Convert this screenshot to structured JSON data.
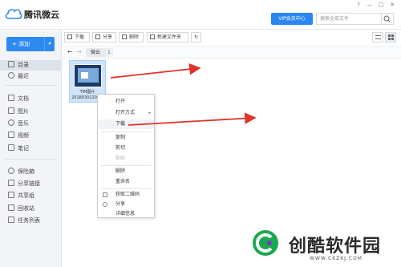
{
  "app": {
    "title": "腾讯微云",
    "vip_label": "VIP会员中心",
    "search_placeholder": "搜索全部文件",
    "window_controls": [
      "?",
      "—",
      "□",
      "✕"
    ]
  },
  "sidebar": {
    "upload_label": "+ 添加",
    "items": [
      {
        "label": "目录",
        "icon": "folder-icon",
        "active": true
      },
      {
        "label": "最近",
        "icon": "clock-icon",
        "active": false
      },
      {
        "label": "文档",
        "icon": "document-icon",
        "active": false
      },
      {
        "label": "图片",
        "icon": "image-icon",
        "active": false
      },
      {
        "label": "音乐",
        "icon": "music-icon",
        "active": false
      },
      {
        "label": "视频",
        "icon": "video-icon",
        "active": false
      },
      {
        "label": "笔记",
        "icon": "note-icon",
        "active": false
      },
      {
        "label": "保险箱",
        "icon": "safe-icon",
        "active": false
      },
      {
        "label": "分享链接",
        "icon": "share-link-icon",
        "active": false
      },
      {
        "label": "共享组",
        "icon": "group-icon",
        "active": false
      },
      {
        "label": "回收站",
        "icon": "trash-icon",
        "active": false
      },
      {
        "label": "任务列表",
        "icon": "task-list-icon",
        "active": false
      }
    ]
  },
  "toolbar": {
    "download": "下载",
    "share": "分享",
    "delete": "删除",
    "new_folder": "新建文件夹"
  },
  "breadcrumb": {
    "current": "微云",
    "count": "1"
  },
  "file": {
    "name_line1": "TIM图片",
    "name_line2": "20180301204..."
  },
  "context_menu": {
    "items": [
      {
        "label": "打开",
        "disabled": false
      },
      {
        "label": "打开方式",
        "disabled": false,
        "submenu": "▸"
      },
      {
        "label": "下载",
        "disabled": false
      },
      {
        "label": "复制",
        "disabled": false
      },
      {
        "label": "剪切",
        "disabled": false
      },
      {
        "label": "粘贴",
        "disabled": true
      },
      {
        "label": "删除",
        "disabled": false
      },
      {
        "label": "重命名",
        "disabled": false
      },
      {
        "label": "获取二维码",
        "disabled": false,
        "icon": "qr-icon"
      },
      {
        "label": "分享",
        "disabled": false,
        "icon": "share-icon"
      },
      {
        "label": "详细信息",
        "disabled": false
      }
    ]
  },
  "watermark": {
    "title": "创酷软件园",
    "url": "WWW.CKZKJ.COM"
  },
  "colors": {
    "accent": "#2e89f0",
    "arrow": "#e0322a",
    "selection": "#cfe4fa"
  }
}
